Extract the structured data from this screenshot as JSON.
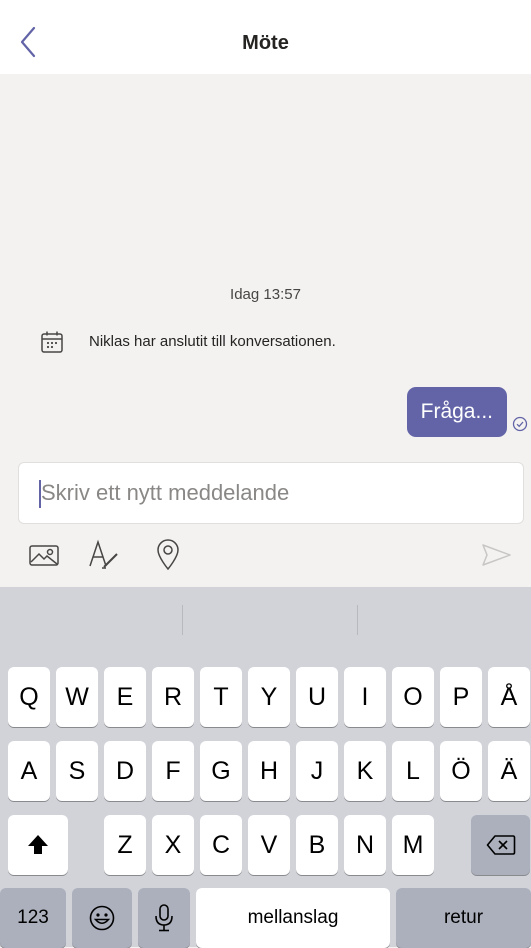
{
  "header": {
    "title": "Möte"
  },
  "chat": {
    "timestamp": "Idag 13:57",
    "system_message": "Niklas har anslutit till konversationen.",
    "messages": [
      {
        "text": "Fråga...",
        "status": "sent"
      }
    ]
  },
  "compose": {
    "placeholder": "Skriv ett nytt meddelande",
    "value": ""
  },
  "toolbar": {
    "icons": [
      "image-icon",
      "format-text-icon",
      "location-icon",
      "send-icon"
    ]
  },
  "keyboard": {
    "row1": [
      "Q",
      "W",
      "E",
      "R",
      "T",
      "Y",
      "U",
      "I",
      "O",
      "P",
      "Å"
    ],
    "row2": [
      "A",
      "S",
      "D",
      "F",
      "G",
      "H",
      "J",
      "K",
      "L",
      "Ö",
      "Ä"
    ],
    "row3": [
      "Z",
      "X",
      "C",
      "V",
      "B",
      "N",
      "M"
    ],
    "numbers_label": "123",
    "space_label": "mellanslag",
    "return_label": "retur"
  },
  "colors": {
    "accent": "#6264a7",
    "background": "#f3f2f1",
    "keyboard": "#d1d3d9"
  }
}
